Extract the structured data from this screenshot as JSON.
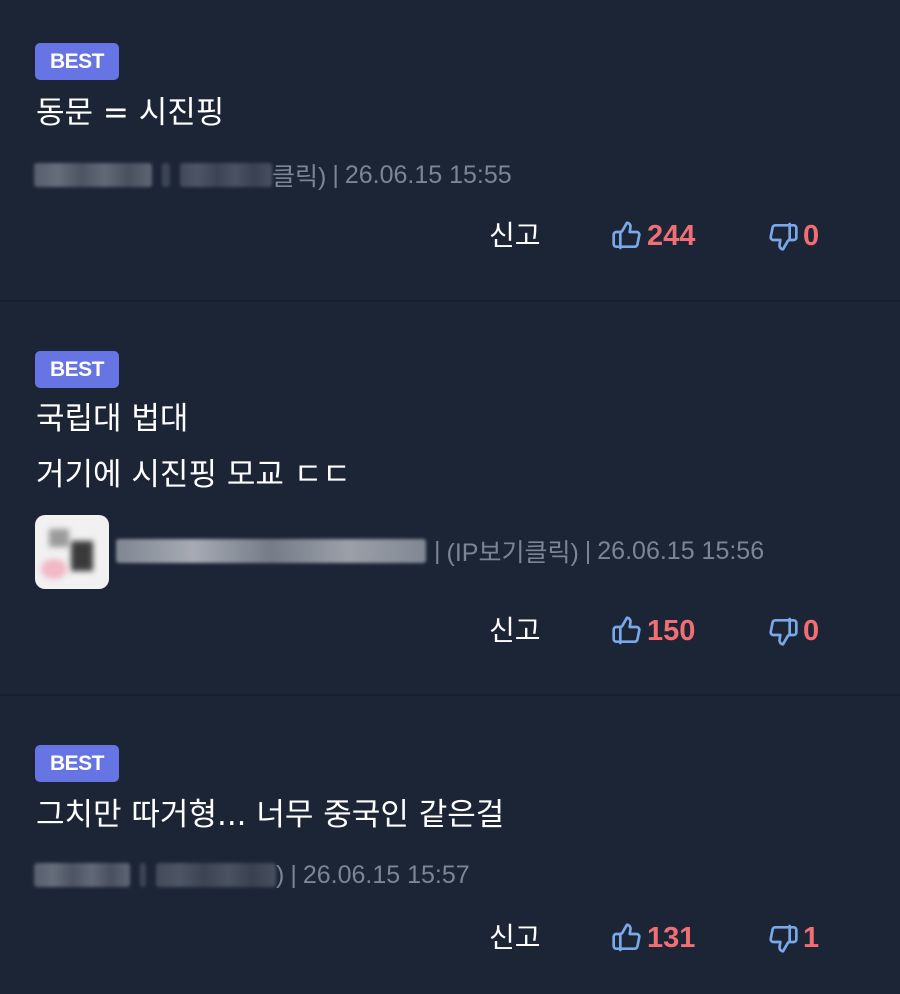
{
  "colors": {
    "background": "#1c2536",
    "badge": "#6674e4",
    "vote_count": "#f06e74",
    "thumb_icon": "#7aa8e8",
    "meta_text": "#7c8594"
  },
  "comments": [
    {
      "badge": "BEST",
      "lines": [
        "동문 = 시진핑"
      ],
      "meta": {
        "ip_partial": "클릭)",
        "separator": "|",
        "timestamp": "26.06.15 15:55"
      },
      "actions": {
        "report_label": "신고",
        "upvote_icon": "thumbs-up-icon",
        "upvotes": "244",
        "downvote_icon": "thumbs-down-icon",
        "downvotes": "0"
      }
    },
    {
      "badge": "BEST",
      "lines": [
        "국립대 법대",
        "거기에 시진핑 모교 ㄷㄷ"
      ],
      "meta": {
        "separator1": "|",
        "ip_label": "(IP보기클릭)",
        "separator2": "|",
        "timestamp": "26.06.15 15:56"
      },
      "actions": {
        "report_label": "신고",
        "upvote_icon": "thumbs-up-icon",
        "upvotes": "150",
        "downvote_icon": "thumbs-down-icon",
        "downvotes": "0"
      }
    },
    {
      "badge": "BEST",
      "lines": [
        "그치만 따거형... 너무 중국인 같은걸"
      ],
      "meta": {
        "ip_partial": ")",
        "separator": "|",
        "timestamp": "26.06.15 15:57"
      },
      "actions": {
        "report_label": "신고",
        "upvote_icon": "thumbs-up-icon",
        "upvotes": "131",
        "downvote_icon": "thumbs-down-icon",
        "downvotes": "1"
      }
    }
  ]
}
